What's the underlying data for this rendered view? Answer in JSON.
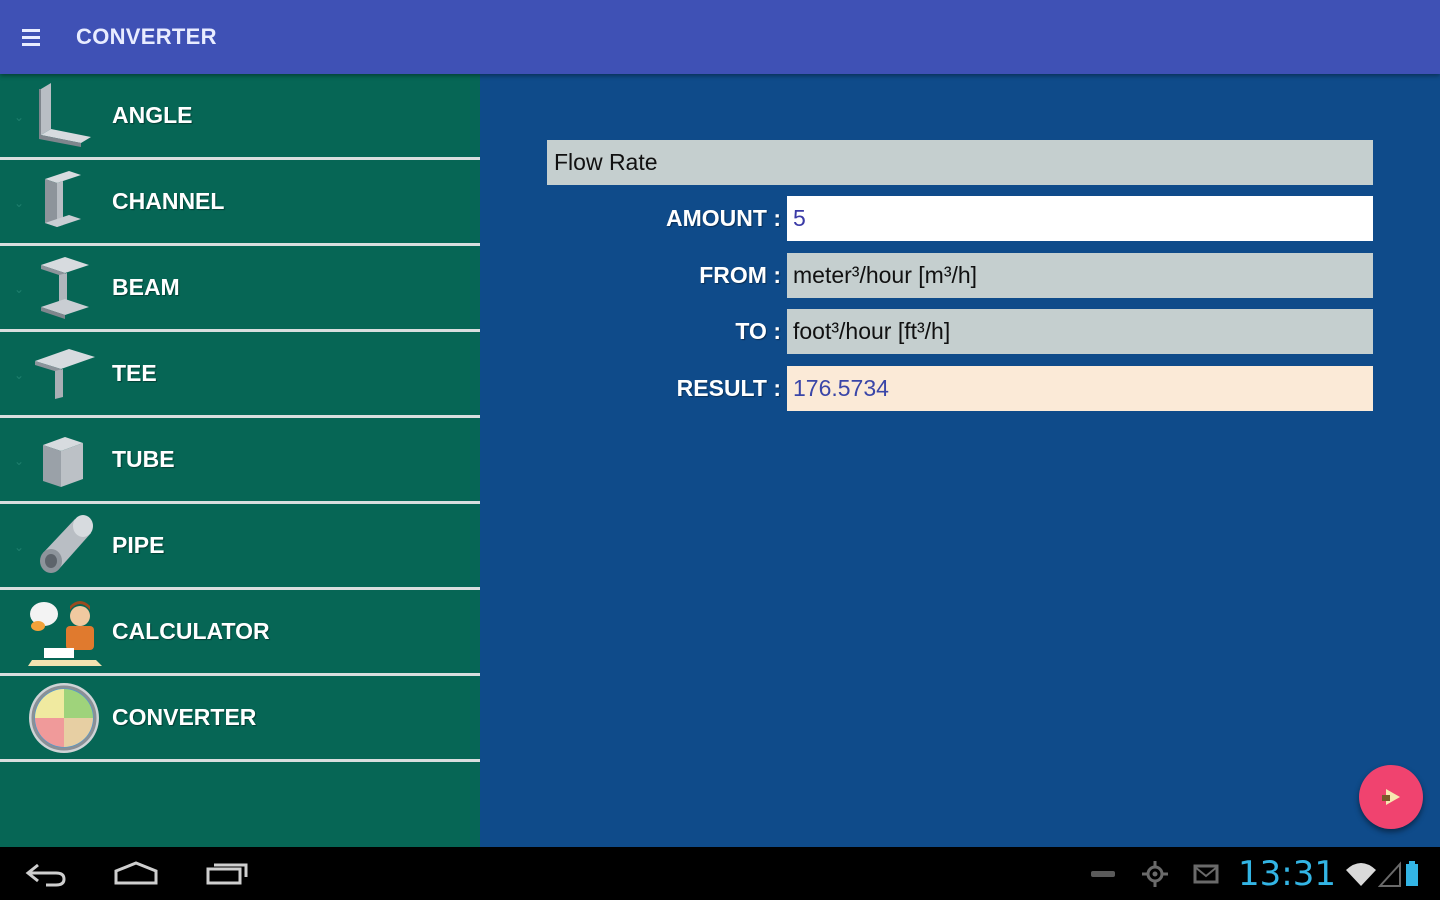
{
  "app_bar": {
    "title": "CONVERTER"
  },
  "sidebar": {
    "items": [
      {
        "label": "ANGLE",
        "icon": "angle-profile-icon"
      },
      {
        "label": "CHANNEL",
        "icon": "channel-profile-icon"
      },
      {
        "label": "BEAM",
        "icon": "beam-profile-icon"
      },
      {
        "label": "TEE",
        "icon": "tee-profile-icon"
      },
      {
        "label": "TUBE",
        "icon": "tube-profile-icon"
      },
      {
        "label": "PIPE",
        "icon": "pipe-profile-icon"
      },
      {
        "label": "CALCULATOR",
        "icon": "calculator-person-icon"
      },
      {
        "label": "CONVERTER",
        "icon": "converter-globe-icon"
      }
    ]
  },
  "converter": {
    "category": "Flow Rate",
    "amount_label": "AMOUNT :",
    "amount_value": "5",
    "from_label": "FROM :",
    "from_value": "meter³/hour [m³/h]",
    "to_label": "TO :",
    "to_value": "foot³/hour [ft³/h]",
    "result_label": "RESULT :",
    "result_value": "176.5734"
  },
  "status_bar": {
    "time": "13:31"
  },
  "colors": {
    "app_bar": "#3f51b5",
    "sidebar": "#066655",
    "main_bg": "#0f4b8a",
    "fab": "#f0436f",
    "clock": "#33b5e5"
  }
}
